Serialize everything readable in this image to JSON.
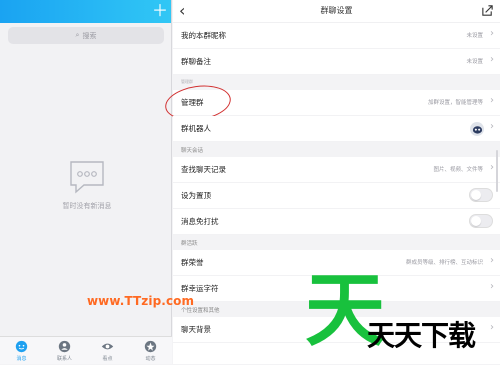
{
  "left": {
    "search_placeholder": "搜索",
    "empty_text": "暂时没有新消息",
    "nav": [
      {
        "label": "消息",
        "icon": "message-icon",
        "active": true
      },
      {
        "label": "联系人",
        "icon": "contacts-icon",
        "active": false
      },
      {
        "label": "看点",
        "icon": "eye-icon",
        "active": false
      },
      {
        "label": "动态",
        "icon": "star-icon",
        "active": false
      }
    ]
  },
  "right": {
    "title": "群聊设置",
    "rows": [
      {
        "label": "我的本群昵称",
        "value": "未设置"
      },
      {
        "label": "群聊备注",
        "value": "未设置"
      }
    ],
    "manage_section": "管理群",
    "manage_rows": [
      {
        "label": "管理群",
        "value": "加群设置，智能管理等"
      },
      {
        "label": "群机器人",
        "value": ""
      }
    ],
    "chat_section": "聊天会话",
    "chat_rows": [
      {
        "label": "查找聊天记录",
        "value": "图片、视频、文件等"
      },
      {
        "label": "设为置顶",
        "value": ""
      },
      {
        "label": "消息免打扰",
        "value": ""
      }
    ],
    "active_section": "群活跃",
    "active_rows": [
      {
        "label": "群荣誉",
        "value": "群成员等级、排行榜、互动标识"
      },
      {
        "label": "群幸运字符",
        "value": ""
      }
    ],
    "personal_section": "个性设置和其他",
    "personal_rows": [
      {
        "label": "聊天背景",
        "value": ""
      }
    ]
  },
  "watermark": {
    "url": "www.TTzip.com",
    "brand": "天天下载",
    "logo": "天"
  },
  "colors": {
    "accent": "#1ea0f0",
    "circle": "#d23131",
    "watermark_green": "#18c13d",
    "watermark_orange": "#ff6a22"
  }
}
